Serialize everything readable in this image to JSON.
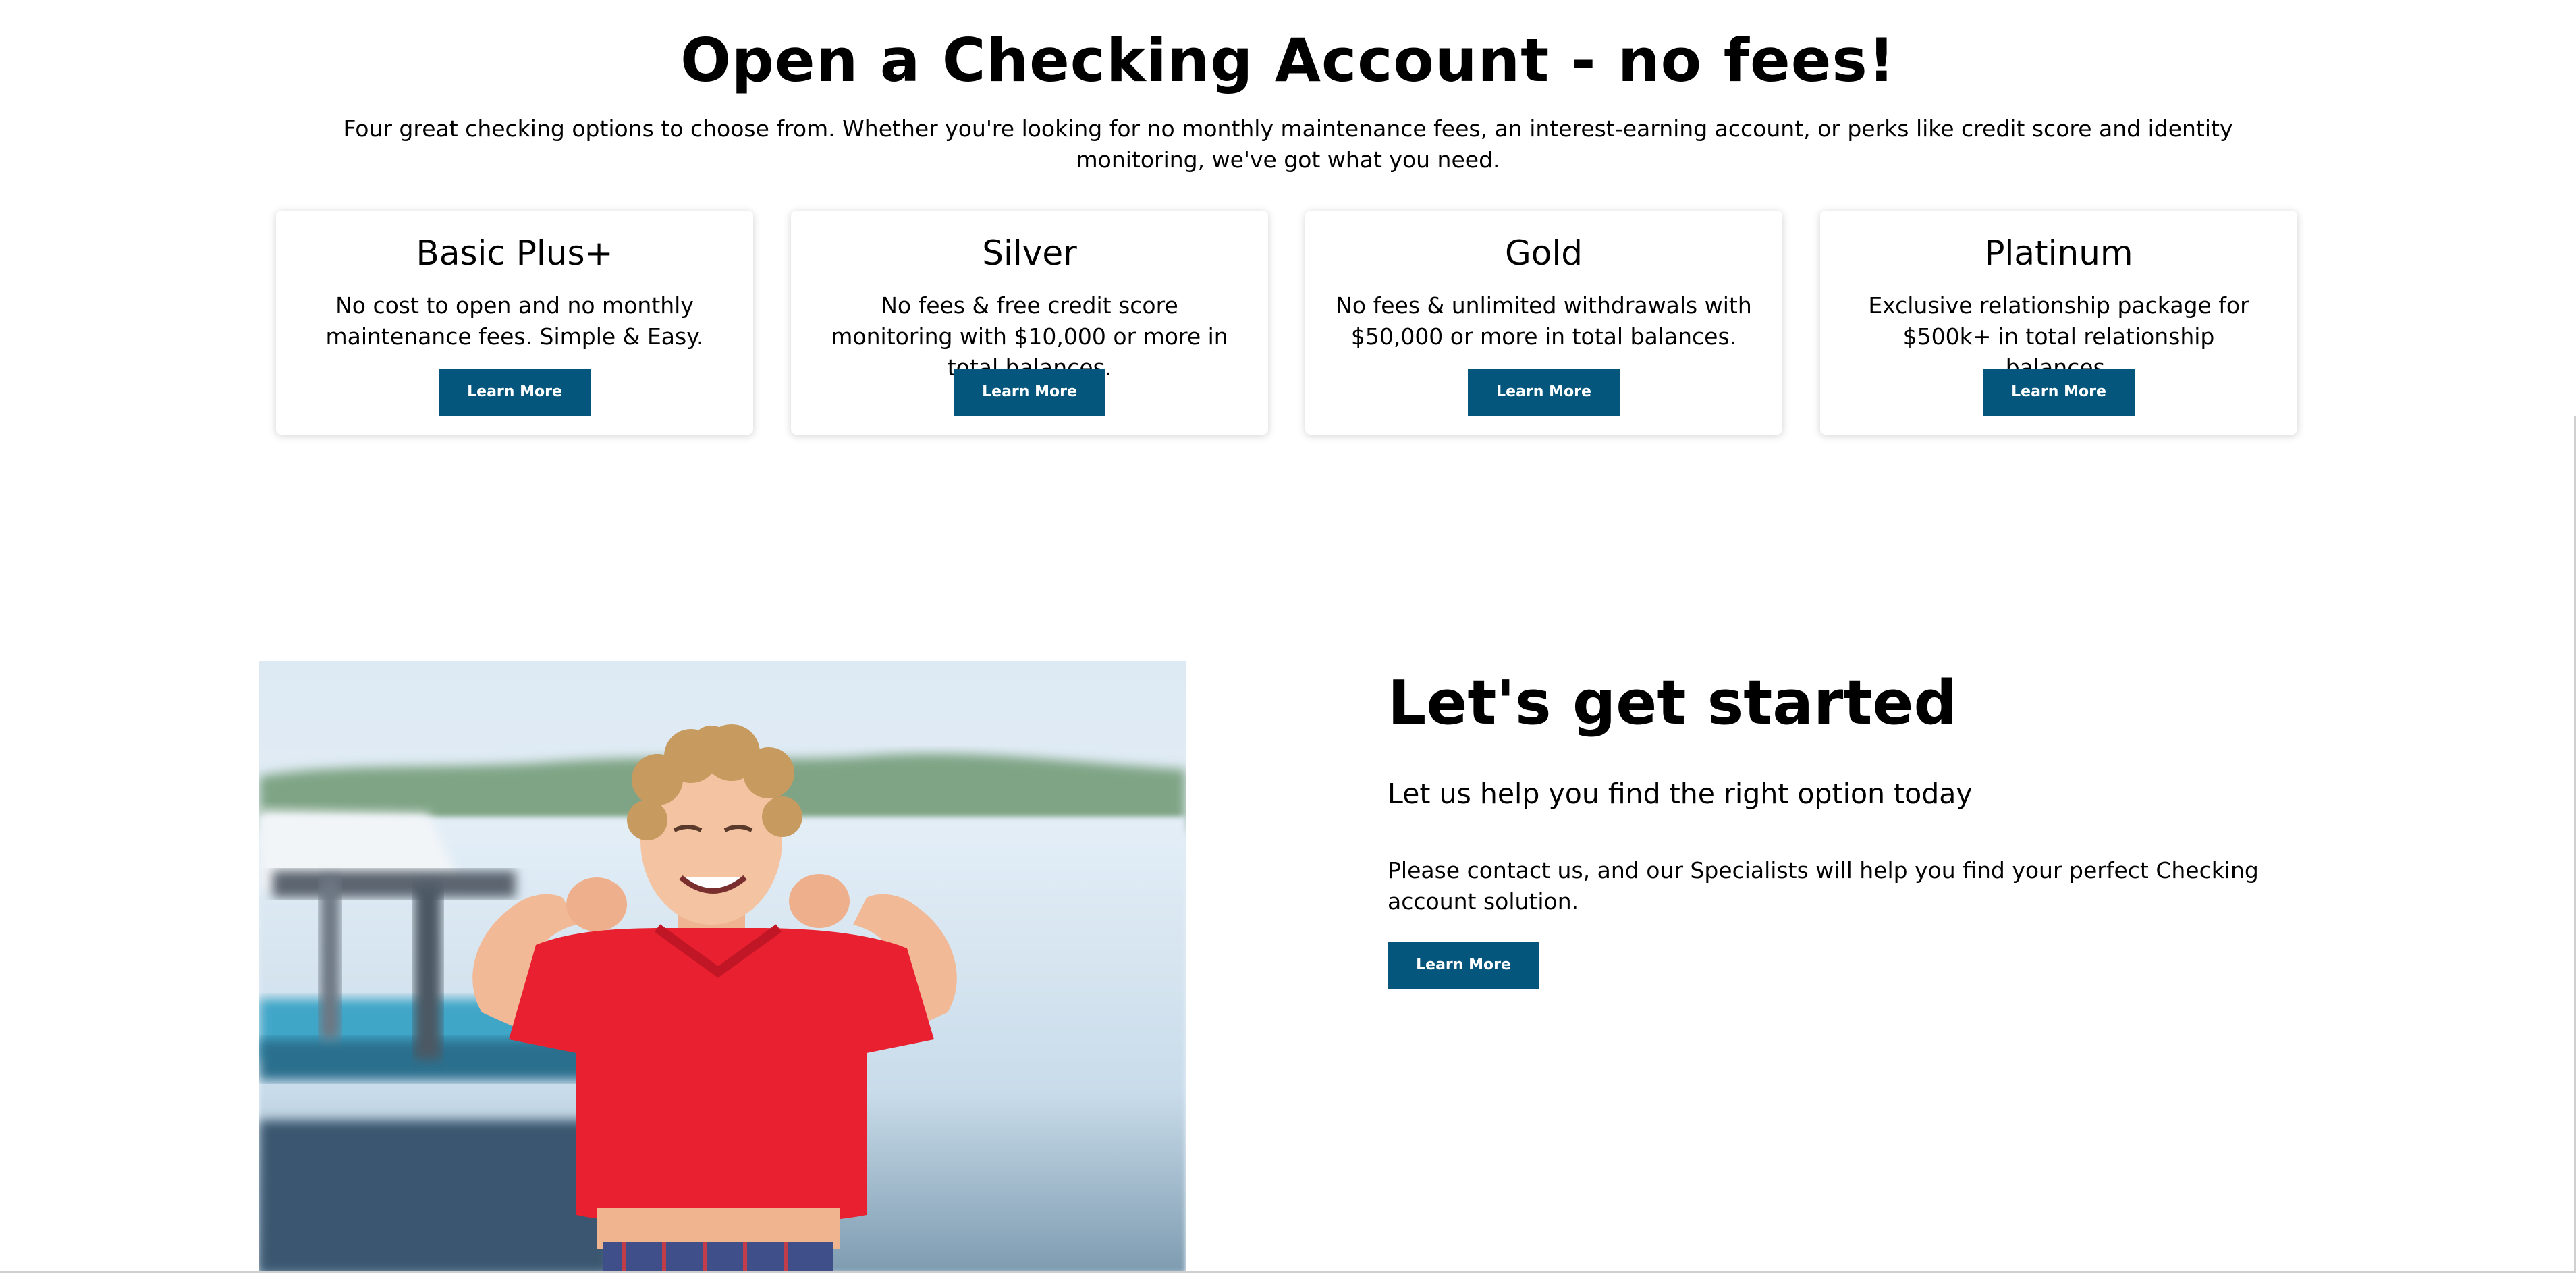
{
  "hero": {
    "title": "Open a Checking Account - no fees!",
    "subtitle": "Four great checking options to choose from. Whether you're looking for no monthly maintenance fees, an interest-earning account, or perks like credit score and identity monitoring, we've got what you need."
  },
  "cards": [
    {
      "title": "Basic Plus+",
      "description": "No cost to open and no monthly maintenance fees. Simple & Easy.",
      "button_label": "Learn More"
    },
    {
      "title": "Silver",
      "description": "No fees & free credit score monitoring with $10,000 or more in total balances.",
      "button_label": "Learn More"
    },
    {
      "title": "Gold",
      "description": "No fees & unlimited withdrawals with $50,000 or more in total balances.",
      "button_label": "Learn More"
    },
    {
      "title": "Platinum",
      "description": "Exclusive relationship package for $500k+ in total relationship balances.",
      "button_label": "Learn More"
    }
  ],
  "get_started": {
    "title": "Let's get started",
    "subtitle": "Let us help you find the right option today",
    "body": "Please contact us, and our Specialists will help you find your perfect Checking account solution.",
    "button_label": "Learn More"
  },
  "colors": {
    "button_bg": "#04567c",
    "button_text": "#ffffff",
    "shirt": "#e8202f"
  }
}
